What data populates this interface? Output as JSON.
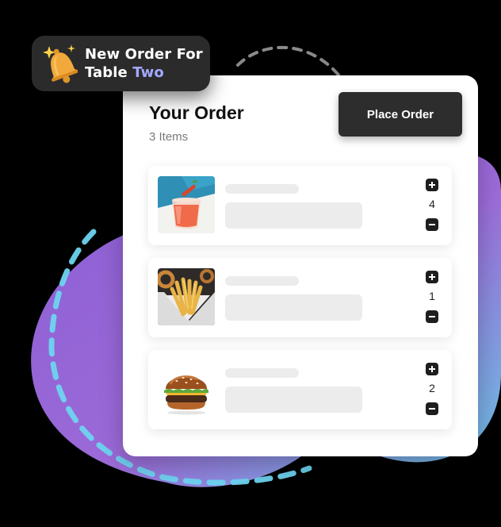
{
  "notification": {
    "line1": "New Order For",
    "line2_prefix": "Table ",
    "line2_accent": "Two",
    "icon": "bell-icon",
    "accent_color": "#a4a8ff"
  },
  "order": {
    "title": "Your Order",
    "item_count": "3 Items",
    "place_order_label": "Place Order",
    "items": [
      {
        "image": "drink",
        "quantity": "4"
      },
      {
        "image": "fries",
        "quantity": "1"
      },
      {
        "image": "burger",
        "quantity": "2"
      }
    ]
  },
  "colors": {
    "blob_start": "#9b6ad6",
    "blob_end": "#6cc8e6",
    "button": "#2d2d2d"
  }
}
